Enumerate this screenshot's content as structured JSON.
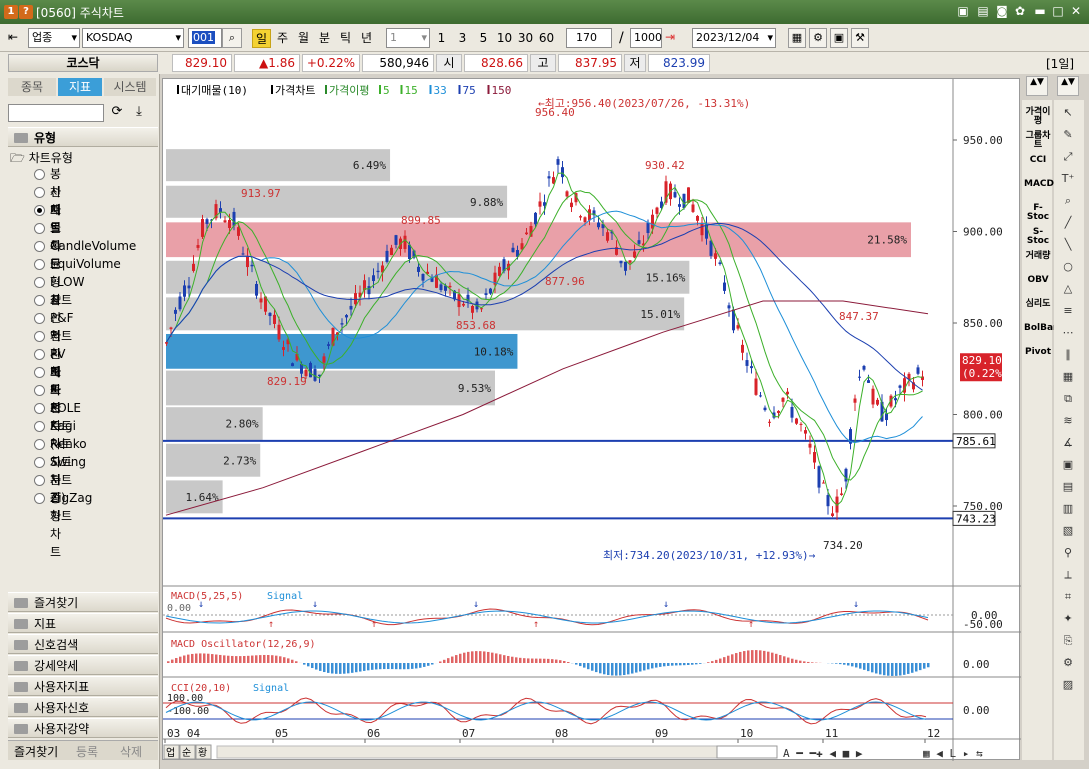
{
  "window": {
    "title": "[0560] 주식차트",
    "icon_labels": [
      "1",
      "?"
    ]
  },
  "toolbar": {
    "market": "업종",
    "code": "KOSDAQ",
    "input_code": "001",
    "periods": [
      "일",
      "주",
      "월",
      "분",
      "틱",
      "년"
    ],
    "interval": "1",
    "presets": [
      "1",
      "3",
      "5",
      "10",
      "30",
      "60"
    ],
    "count": "170",
    "total": "1000",
    "date": "2023/12/04"
  },
  "quote": {
    "name": "코스닥",
    "price": "829.10",
    "change": "▲1.86",
    "pct": "+0.22%",
    "volume": "580,946",
    "open_label": "시",
    "open": "828.66",
    "high_label": "고",
    "high": "837.95",
    "low_label": "저",
    "low": "823.99",
    "period_badge": "[1일]"
  },
  "left": {
    "tabs": [
      "종목",
      "지표",
      "시스템"
    ],
    "type_header": "유형",
    "chart_type_header": "차트유형",
    "chart_types": [
      "봉차트",
      "선차트",
      "매물차트",
      "일목균형표",
      "CandleVolume",
      "EquiVolume",
      "FLOW차트",
      "삼선전환도",
      "P&F차트",
      "역시계곡선",
      "PV차트",
      "바차트",
      "바차트(시고저종)",
      "POLE차트",
      "Kagi차트",
      "Renko차트",
      "Swing차트",
      "분산형차트",
      "ZigZag차트"
    ],
    "selected_type": "매물차트",
    "categories": [
      "즐겨찾기",
      "지표",
      "신호검색",
      "강세약세",
      "사용자지표",
      "사용자신호",
      "사용자강약"
    ],
    "bottom_tabs": [
      "즐겨찾기",
      "등록",
      "삭제"
    ]
  },
  "chart": {
    "legend": [
      "대기매물(10)",
      "가격차트",
      "가격이평",
      "5",
      "15",
      "33",
      "75",
      "150"
    ],
    "high_note": "←최고:956.40(2023/07/26, -13.31%)",
    "low_note": "최저:734.20(2023/10/31, +12.93%)→",
    "price_labels": [
      "956.40",
      "930.42",
      "913.97",
      "899.85",
      "877.96",
      "853.68",
      "829.19",
      "847.37",
      "734.20"
    ],
    "volume_profile_pcts": [
      "6.49%",
      "9.88%",
      "21.58%",
      "15.16%",
      "15.01%",
      "10.18%",
      "9.53%",
      "2.80%",
      "2.73%",
      "1.64%"
    ],
    "y_ticks": [
      "950.00",
      "900.00",
      "850.00",
      "800.00",
      "750.00"
    ],
    "last_price": "829.10",
    "last_pct": "(0.22%)",
    "hlines": [
      "785.61",
      "743.23"
    ],
    "x_ticks": [
      "03 04",
      "05",
      "06",
      "07",
      "08",
      "09",
      "10",
      "11",
      "12"
    ],
    "macd_title": "MACD(5,25,5)",
    "macd_signal": "Signal",
    "macd_left": "0.00",
    "macd_right": [
      "0.00",
      "-50.00"
    ],
    "osc_title": "MACD Oscillator(12,26,9)",
    "osc_right": "0.00",
    "cci_title": "CCI(20,10)",
    "cci_signal": "Signal",
    "cci_left": [
      "100.00",
      "-100.00"
    ],
    "cci_right": "0.00",
    "bottom_buttons": [
      "업",
      "순",
      "황"
    ]
  },
  "rightbar": [
    "가격이평",
    "그룹차트",
    "CCI",
    "MACD",
    "F-Stoc",
    "S-Stoc",
    "거래량",
    "OBV",
    "심리도",
    "BolBand",
    "Pivot"
  ],
  "colors": {
    "up": "#d8232a",
    "down": "#1c3fb0",
    "ma5": "#3cb02a",
    "ma15": "#3cb02a",
    "ma33": "#1e8fd8",
    "ma75": "#1c3fb0",
    "ma150": "#8b1a3a",
    "title_bg": "#3d6b30"
  }
}
